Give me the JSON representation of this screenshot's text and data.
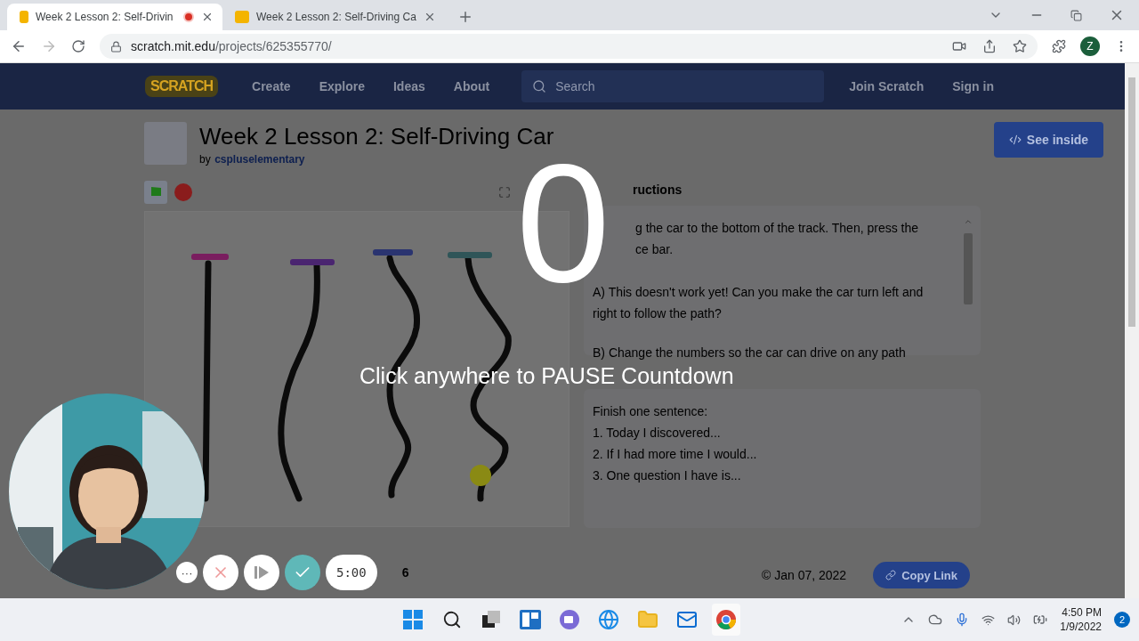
{
  "browser": {
    "tabs": [
      {
        "title": "Week 2 Lesson 2: Self-Drivin",
        "selected": true,
        "recording": true
      },
      {
        "title": "Week 2 Lesson 2: Self-Driving Ca",
        "selected": false,
        "recording": false
      }
    ],
    "url_host": "scratch.mit.edu",
    "url_path": "/projects/625355770/",
    "profile": "Z"
  },
  "nav": {
    "logo": "SCRATCH",
    "items": [
      "Create",
      "Explore",
      "Ideas",
      "About"
    ],
    "search": {
      "placeholder": "Search"
    },
    "join": "Join Scratch",
    "sign_in": "Sign in"
  },
  "project": {
    "title": "Week 2 Lesson 2: Self-Driving Car",
    "by": "by",
    "author": "cspluselementary",
    "see_inside": "See inside"
  },
  "instructions": {
    "heading": "ructions",
    "paragraphs": [
      "g the car to the bottom of the track. Then, press the",
      "ce bar.",
      "A) This doesn't work yet! Can you make the car turn left and right to follow the path?",
      "B) Change the numbers so the car can drive on any path"
    ]
  },
  "notes": {
    "lines": [
      "Finish one sentence:",
      "1. Today I discovered...",
      "2. If I had more time I would...",
      "3. One question I have is..."
    ]
  },
  "footer": {
    "date": "© Jan 07, 2022",
    "copy_link": "Copy Link"
  },
  "countdown": {
    "number": "0",
    "message": "Click anywhere to PAUSE Countdown"
  },
  "timer": {
    "more": "···",
    "time": "5:00",
    "count": "6"
  },
  "taskbar": {
    "time": "4:50 PM",
    "date": "1/9/2022",
    "badge": "2"
  }
}
